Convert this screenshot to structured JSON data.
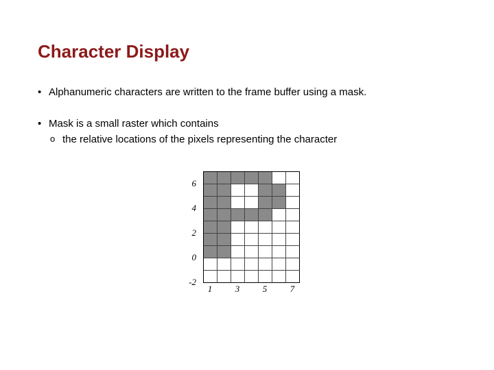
{
  "title": "Character Display",
  "bullets": [
    {
      "text": "Alphanumeric characters are written to the frame buffer using a mask."
    },
    {
      "text": "Mask is a small raster which contains",
      "sub": [
        "the relative locations of the pixels representing the character"
      ]
    }
  ],
  "chart_data": {
    "type": "heatmap",
    "title": "",
    "xlabel": "",
    "ylabel": "",
    "x_ticks": [
      1,
      3,
      5,
      7
    ],
    "y_ticks": [
      -2,
      0,
      2,
      4,
      6
    ],
    "x_range": [
      1,
      7
    ],
    "y_range": [
      -2,
      6
    ],
    "cols": 7,
    "rows": 9,
    "filled_cells": [
      [
        1,
        6
      ],
      [
        2,
        6
      ],
      [
        3,
        6
      ],
      [
        4,
        6
      ],
      [
        5,
        6
      ],
      [
        1,
        5
      ],
      [
        2,
        5
      ],
      [
        5,
        5
      ],
      [
        6,
        5
      ],
      [
        1,
        4
      ],
      [
        2,
        4
      ],
      [
        5,
        4
      ],
      [
        6,
        4
      ],
      [
        1,
        3
      ],
      [
        2,
        3
      ],
      [
        3,
        3
      ],
      [
        4,
        3
      ],
      [
        5,
        3
      ],
      [
        1,
        2
      ],
      [
        2,
        2
      ],
      [
        1,
        1
      ],
      [
        2,
        1
      ],
      [
        1,
        0
      ],
      [
        2,
        0
      ]
    ]
  }
}
